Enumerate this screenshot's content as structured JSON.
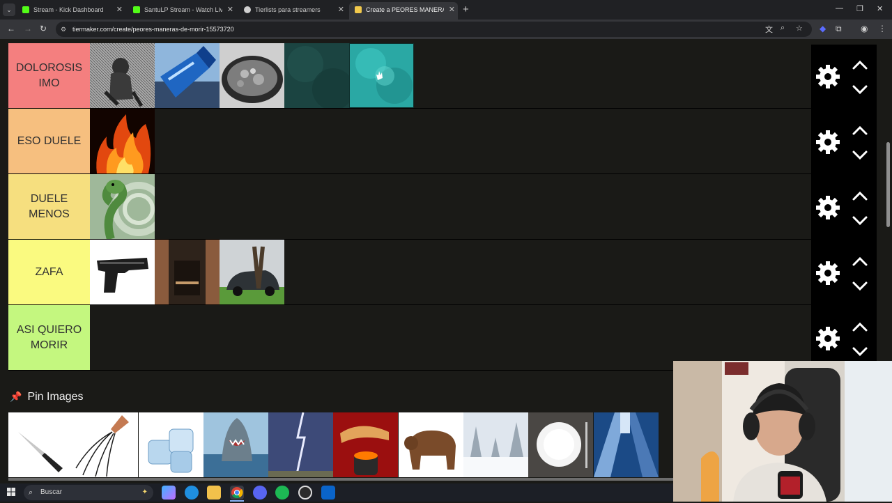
{
  "browser": {
    "tabs": [
      {
        "label": "Stream - Kick Dashboard",
        "icon": "kick-icon",
        "color": "#53fc18",
        "active": false
      },
      {
        "label": "SantuLP Stream - Watch Live on",
        "icon": "kick-icon",
        "color": "#53fc18",
        "active": false
      },
      {
        "label": "Tierlists para streamers",
        "icon": "globe-icon",
        "color": "#d0d0d0",
        "active": false
      },
      {
        "label": "Create a PEORES MANERAS DE",
        "icon": "tiermaker-icon",
        "color": "#f2c94c",
        "active": true
      }
    ],
    "url": "tiermaker.com/create/peores-maneras-de-morir-15573720",
    "tab_close_glyph": "✕",
    "new_tab_glyph": "+"
  },
  "tiers": [
    {
      "label": "DOLOROSIS IMO",
      "color": "#f47f7f",
      "items": [
        "engraving-figure",
        "water-bottle",
        "boiling-pot",
        "deep-water-dark",
        "deep-water-bright"
      ]
    },
    {
      "label": "ESO DUELE",
      "color": "#f6bf7f",
      "items": [
        "fire"
      ]
    },
    {
      "label": "DUELE MENOS",
      "color": "#f6df7f",
      "items": [
        "snake"
      ]
    },
    {
      "label": "ZAFA",
      "color": "#fafa80",
      "items": [
        "pistol",
        "elevator-shaft",
        "car-crash"
      ]
    },
    {
      "label": "ASI QUIERO MORIR",
      "color": "#c4f77f",
      "items": []
    }
  ],
  "pin_section": {
    "title": "Pin Images",
    "icon": "pushpin-icon",
    "items": [
      "knife",
      "whip",
      "ice-cubes",
      "shark",
      "lightning",
      "lava-figure",
      "bear",
      "snow-forest",
      "empty-plate",
      "skyscrapers"
    ]
  },
  "taskbar": {
    "search_label": "Buscar",
    "apps": [
      "copilot-icon",
      "edge-icon",
      "file-explorer-icon",
      "chrome-icon",
      "discord-icon",
      "spotify-icon",
      "obs-icon",
      "outlook-icon"
    ]
  }
}
